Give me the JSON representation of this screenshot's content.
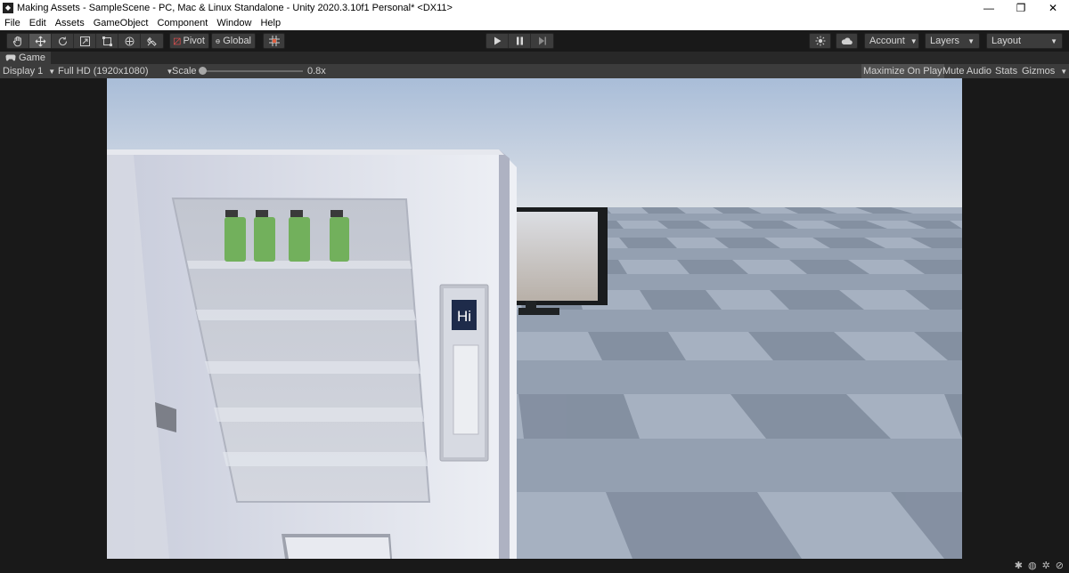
{
  "window": {
    "title": "Making Assets - SampleScene - PC, Mac & Linux Standalone - Unity 2020.3.10f1 Personal* <DX11>",
    "controls": [
      "—",
      "❐",
      "✕"
    ]
  },
  "menu": [
    "File",
    "Edit",
    "Assets",
    "GameObject",
    "Component",
    "Window",
    "Help"
  ],
  "toolbar": {
    "tools": [
      "hand-icon",
      "move-icon",
      "rotate-icon",
      "scale-icon",
      "rect-icon",
      "transform-icon",
      "custom-tool-icon"
    ],
    "pivot_label": "Pivot",
    "global_label": "Global",
    "account_label": "Account",
    "layers_label": "Layers",
    "layout_label": "Layout"
  },
  "game_tab": {
    "label": "Game"
  },
  "game_toolbar": {
    "display": "Display 1",
    "resolution": "Full HD (1920x1080)",
    "scale_label": "Scale",
    "scale_value": "0.8x",
    "scale_fraction": 0.02,
    "maximize_on_play": "Maximize On Play",
    "mute_audio": "Mute Audio",
    "stats": "Stats",
    "gizmos": "Gizmos"
  },
  "scene": {
    "button_text": "Hi",
    "sky_top": "#b2c4dc",
    "sky_bottom": "#d8dde4",
    "floor_dark": "#8a96a6",
    "floor_light": "#a3afbe"
  }
}
